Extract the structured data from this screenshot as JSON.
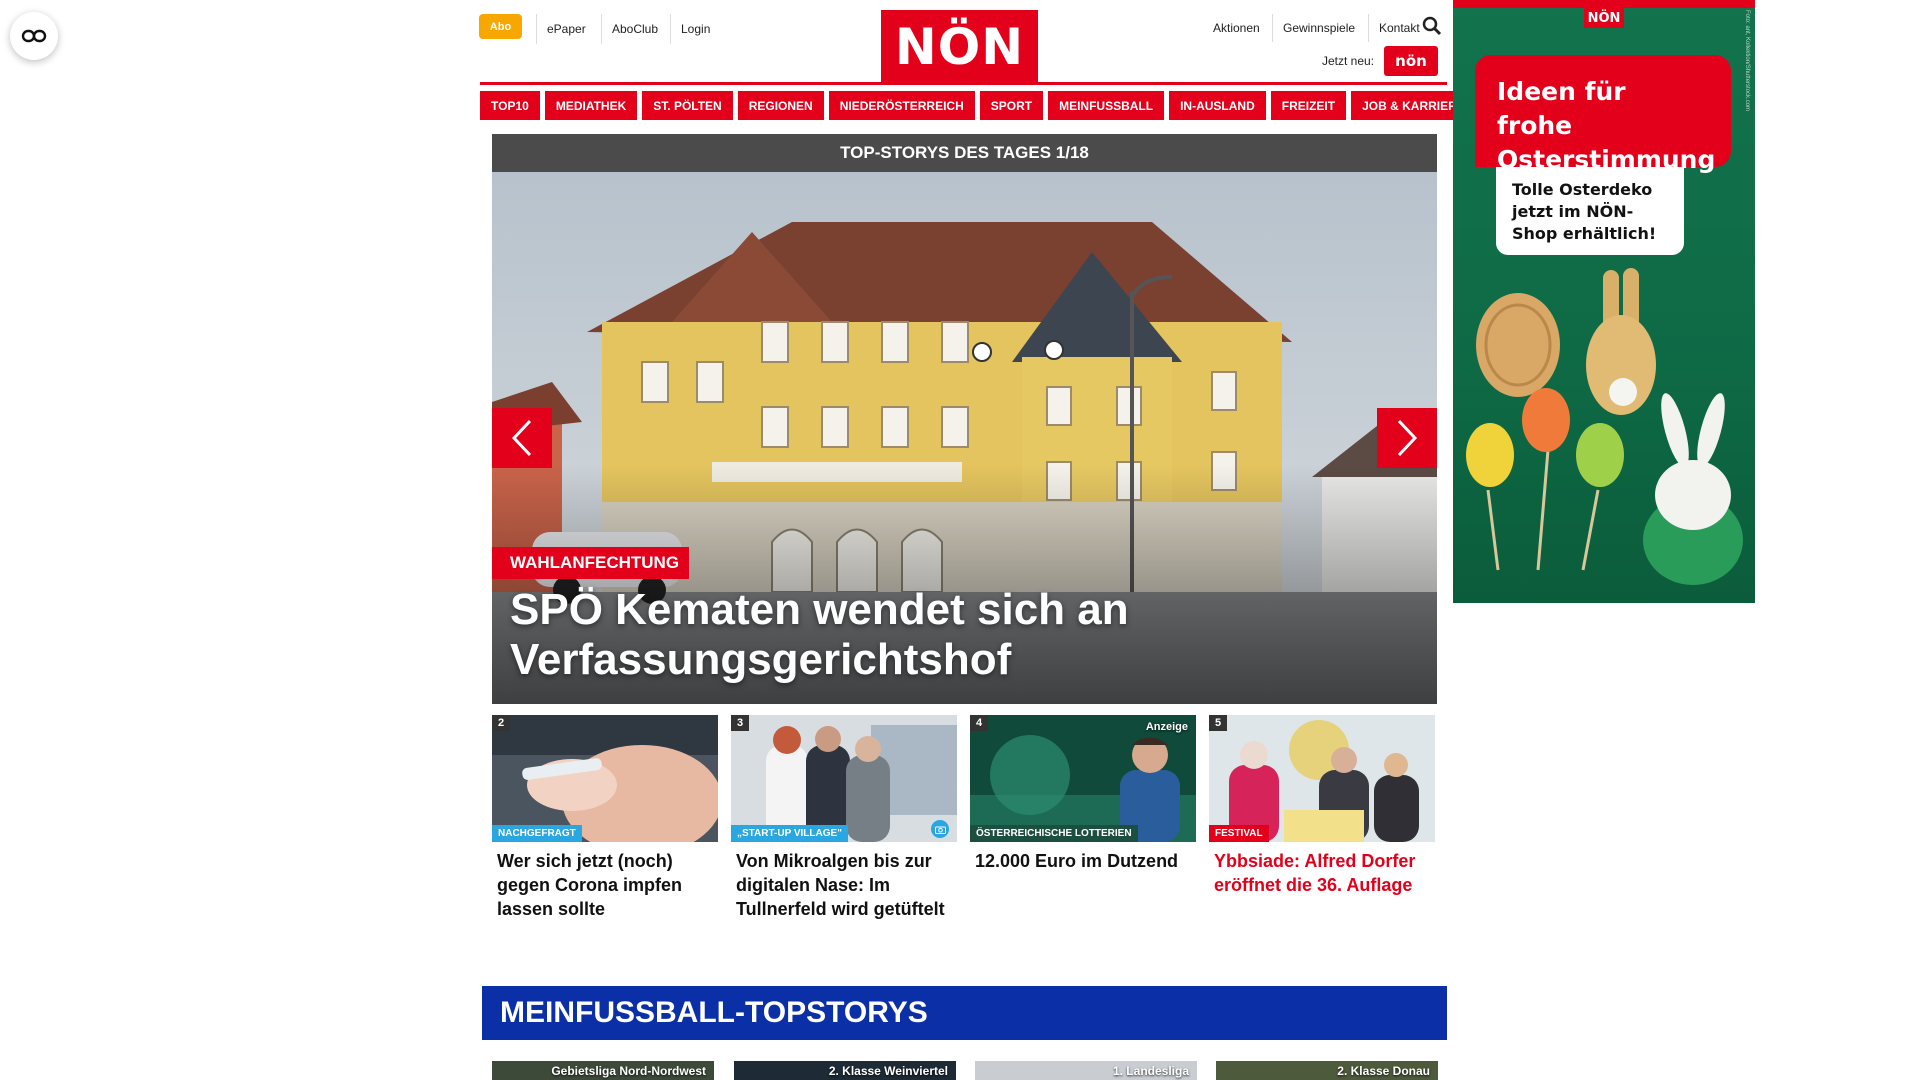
{
  "header": {
    "abo": "Abo",
    "left_links": [
      "ePaper",
      "AboClub",
      "Login"
    ],
    "logo": "NÖN",
    "right_links": [
      "Aktionen",
      "Gewinnspiele",
      "Kontakt"
    ],
    "jetzt_neu": "Jetzt neu:",
    "jetzt_badge": "nön"
  },
  "nav": [
    "TOP10",
    "MEDIATHEK",
    "ST. PÖLTEN",
    "REGIONEN",
    "NIEDERÖSTERREICH",
    "SPORT",
    "MEINFUSSBALL",
    "IN-AUSLAND",
    "FREIZEIT",
    "JOB & KARRIERE"
  ],
  "hero": {
    "bar": "TOP-STORYS DES TAGES 1/18",
    "tag": "WAHLANFECHTUNG",
    "title": "SPÖ Kematen wendet sich an Verfassungsgerichtshof"
  },
  "cards": [
    {
      "num": "2",
      "label": "NACHGEFRAGT",
      "title": "Wer sich jetzt (noch) gegen Corona impfen lassen sollte"
    },
    {
      "num": "3",
      "label": "„START-UP VILLAGE\"",
      "title": "Von Mikroalgen bis zur digitalen Nase: Im Tullnerfeld wird getüftelt"
    },
    {
      "num": "4",
      "label": "ÖSTERREICHISCHE LOTTERIEN",
      "title": "12.000 Euro im Dutzend",
      "anzeige": "Anzeige"
    },
    {
      "num": "5",
      "label": "FESTIVAL",
      "title": "Ybbsiade: Alfred Dorfer eröffnet die 36. Auflage"
    }
  ],
  "football": {
    "title": "MEINFUSSBALL-TOPSTORYS",
    "labels": [
      "Gebietsliga Nord-Nordwest",
      "2. Klasse Weinviertel",
      "1. Landesliga",
      "2. Klasse Donau"
    ]
  },
  "ad": {
    "logo": "NÖN",
    "headline": "Ideen für frohe Osterstimmung",
    "sub": "Tolle Osterdeko jetzt im NÖN-Shop erhältlich!",
    "credit": "Foto: ant, Kollektion/Shutterstock.com"
  },
  "colors": {
    "brand_red": "#e2001a",
    "abo_orange": "#f7a700",
    "football_blue": "#0a2fa6",
    "ad_green": "#12734c",
    "card_label_blue": "#2aa6e0"
  }
}
